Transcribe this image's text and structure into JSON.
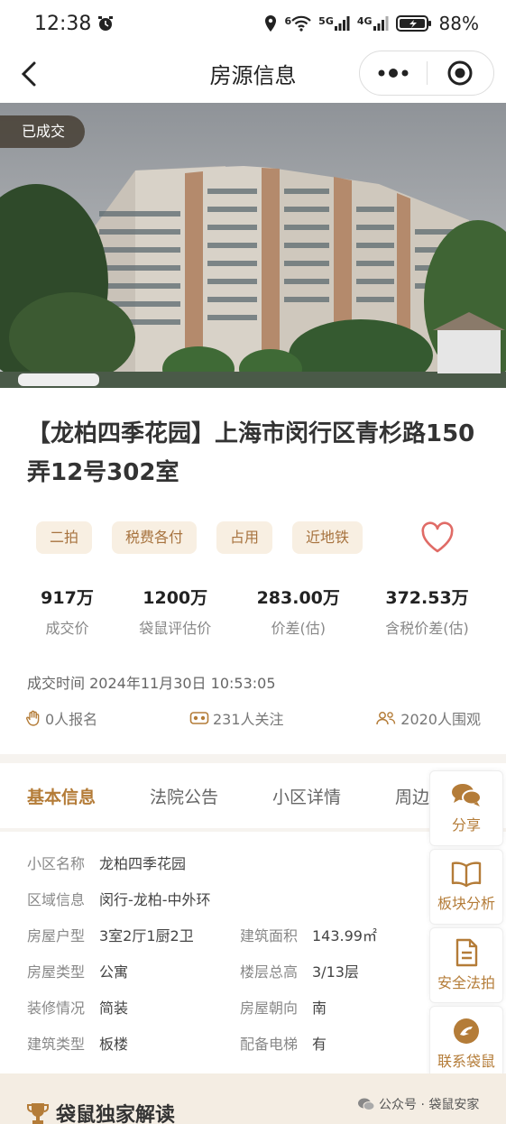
{
  "status_bar": {
    "time": "12:38",
    "battery": "88%",
    "net1": "5G",
    "net2": "4G",
    "wifi_label": "6"
  },
  "nav": {
    "title": "房源信息"
  },
  "hero": {
    "status_tag": "已成交"
  },
  "listing": {
    "title": "【龙柏四季花园】上海市闵行区青杉路150弄12号302室",
    "tags": [
      "二拍",
      "税费各付",
      "占用",
      "近地铁"
    ]
  },
  "stats": [
    {
      "value": "917万",
      "label": "成交价"
    },
    {
      "value": "1200万",
      "label": "袋鼠评估价"
    },
    {
      "value": "283.00万",
      "label": "价差(估)"
    },
    {
      "value": "372.53万",
      "label": "含税价差(估)"
    }
  ],
  "deal": {
    "label": "成交时间",
    "time": "2024年11月30日 10:53:05"
  },
  "counters": {
    "signups": "0人报名",
    "followers": "231人关注",
    "viewers": "2020人围观"
  },
  "tabs": [
    "基本信息",
    "法院公告",
    "小区详情",
    "周边"
  ],
  "info": {
    "community": {
      "label": "小区名称",
      "value": "龙柏四季花园"
    },
    "area": {
      "label": "区域信息",
      "value": "闵行-龙柏-中外环"
    },
    "layout": {
      "label": "房屋户型",
      "value": "3室2厅1厨2卫"
    },
    "build_area": {
      "label": "建筑面积",
      "value": "143.99㎡"
    },
    "house_type": {
      "label": "房屋类型",
      "value": "公寓"
    },
    "floor": {
      "label": "楼层总高",
      "value": "3/13层"
    },
    "decoration": {
      "label": "装修情况",
      "value": "简装"
    },
    "orientation": {
      "label": "房屋朝向",
      "value": "南"
    },
    "building_type": {
      "label": "建筑类型",
      "value": "板楼"
    },
    "elevator": {
      "label": "配备电梯",
      "value": "有"
    }
  },
  "side_buttons": [
    "分享",
    "板块分析",
    "安全法拍",
    "联系袋鼠"
  ],
  "bottom": {
    "exclusive": "袋鼠独家解读",
    "watermark": "公众号 · 袋鼠安家"
  },
  "colors": {
    "accent": "#b47c38",
    "tag_bg": "#f8efe2",
    "heart": "#e06b66"
  }
}
